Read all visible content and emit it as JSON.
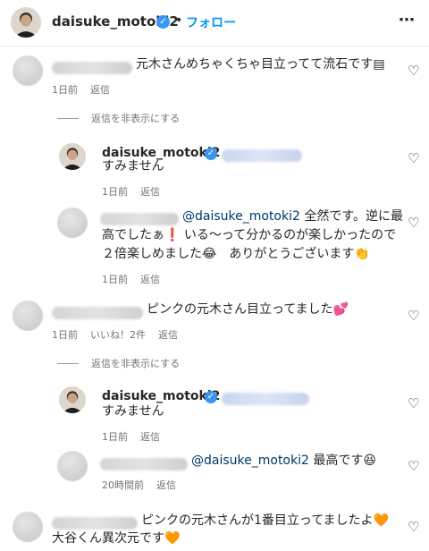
{
  "header": {
    "username": "daisuke_motoki2",
    "dot": "•",
    "follow_label": "フォロー",
    "more_icon": "more-horizontal-icon"
  },
  "comments": [
    {
      "text": "元木さんめちゃくちゃ目立ってて流石です",
      "emoji": "▤",
      "meta": {
        "time": "1日前",
        "reply": "返信"
      }
    },
    {
      "hide_replies": "返信を非表示にする"
    },
    {
      "username": "daisuke_motoki2",
      "text": "すみません",
      "meta": {
        "time": "1日前",
        "reply": "返信"
      }
    },
    {
      "mention": "@daisuke_motoki2",
      "text_line1": " 全然です。逆に最",
      "text_line2": "高でしたぁ",
      "emoji_exclaim": "❗",
      "text_line2b": " いる〜って分かるのが楽しかったので",
      "text_line3": "２倍楽しめました",
      "emoji_grin": "😂",
      "text_line3b": "　ありがとうございます",
      "emoji_clap": "👏",
      "meta": {
        "time": "1日前",
        "reply": "返信"
      }
    },
    {
      "text": "ピンクの元木さん目立ってました",
      "emoji": "💕",
      "meta": {
        "time": "1日前",
        "likes": "いいね！2件",
        "reply": "返信"
      }
    },
    {
      "hide_replies": "返信を非表示にする"
    },
    {
      "username": "daisuke_motoki2",
      "text": "すみません",
      "meta": {
        "time": "1日前",
        "reply": "返信"
      }
    },
    {
      "mention": "@daisuke_motoki2",
      "text": " 最高です",
      "emoji": "😆",
      "meta": {
        "time": "20時間前",
        "reply": "返信"
      }
    },
    {
      "text_line1": "ピンクの元木さんが1番目立ってましたよ",
      "emoji1": "🧡",
      "text_line2": "大谷くん異次元です",
      "emoji2": "🧡"
    }
  ],
  "icons": {
    "heart": "♡",
    "verified": "✓",
    "more": "⋯"
  },
  "colors": {
    "follow_blue": "#0095f6",
    "verified_blue": "#3897f0",
    "mention_blue": "#00376b",
    "meta_gray": "#737373"
  }
}
